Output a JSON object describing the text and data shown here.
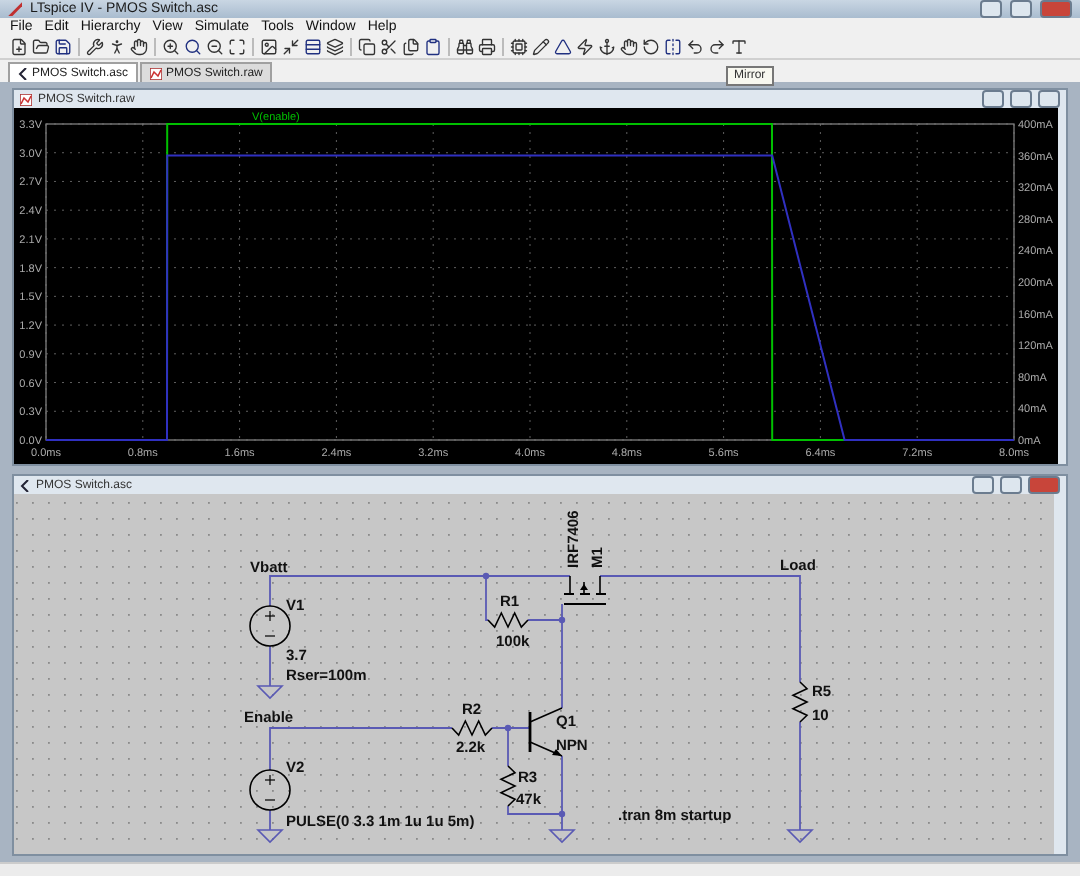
{
  "window": {
    "title": "LTspice IV - PMOS Switch.asc"
  },
  "menu": [
    "File",
    "Edit",
    "Hierarchy",
    "View",
    "Simulate",
    "Tools",
    "Window",
    "Help"
  ],
  "tabs": [
    {
      "label": "PMOS Switch.asc",
      "kind": "schematic",
      "selected": true
    },
    {
      "label": "PMOS Switch.raw",
      "kind": "waveform",
      "selected": false
    }
  ],
  "tooltip": "Mirror",
  "waveform_window": {
    "title": "PMOS Switch.raw",
    "chart_data": {
      "type": "line",
      "grid": true,
      "x": [
        0,
        1,
        1.001,
        6,
        6.001,
        6.6,
        8
      ],
      "xlim": [
        0,
        8
      ],
      "ylim": [
        0,
        3.3
      ],
      "xticks": [
        {
          "value": 0,
          "label": "0.0ms"
        },
        {
          "value": 0.8,
          "label": "0.8ms"
        },
        {
          "value": 1.6,
          "label": "1.6ms"
        },
        {
          "value": 2.4,
          "label": "2.4ms"
        },
        {
          "value": 3.2,
          "label": "3.2ms"
        },
        {
          "value": 4,
          "label": "4.0ms"
        },
        {
          "value": 4.8,
          "label": "4.8ms"
        },
        {
          "value": 5.6,
          "label": "5.6ms"
        },
        {
          "value": 6.4,
          "label": "6.4ms"
        },
        {
          "value": 7.2,
          "label": "7.2ms"
        },
        {
          "value": 8,
          "label": "8.0ms"
        }
      ],
      "yticks": [
        {
          "value": 0,
          "label": "0.0V"
        },
        {
          "value": 0.3,
          "label": "0.3V"
        },
        {
          "value": 0.6,
          "label": "0.6V"
        },
        {
          "value": 0.9,
          "label": "0.9V"
        },
        {
          "value": 1.2,
          "label": "1.2V"
        },
        {
          "value": 1.5,
          "label": "1.5V"
        },
        {
          "value": 1.8,
          "label": "1.8V"
        },
        {
          "value": 2.1,
          "label": "2.1V"
        },
        {
          "value": 2.4,
          "label": "2.4V"
        },
        {
          "value": 2.7,
          "label": "2.7V"
        },
        {
          "value": 3.0,
          "label": "3.0V"
        },
        {
          "value": 3.3,
          "label": "3.3V"
        }
      ],
      "series": [
        {
          "name": "V(enable)",
          "color": "#00c000",
          "values": [
            0,
            0,
            3.3,
            3.3,
            0,
            0,
            0
          ]
        },
        {
          "color": "#3030c0",
          "axis": "y2",
          "values": [
            0,
            0,
            360,
            360,
            360,
            0,
            0
          ]
        }
      ],
      "y2lim": [
        0,
        400
      ],
      "y2ticks": [
        {
          "value": 0,
          "label": "0mA"
        },
        {
          "value": 40,
          "label": "40mA"
        },
        {
          "value": 80,
          "label": "80mA"
        },
        {
          "value": 120,
          "label": "120mA"
        },
        {
          "value": 160,
          "label": "160mA"
        },
        {
          "value": 200,
          "label": "200mA"
        },
        {
          "value": 240,
          "label": "240mA"
        },
        {
          "value": 280,
          "label": "280mA"
        },
        {
          "value": 320,
          "label": "320mA"
        },
        {
          "value": 360,
          "label": "360mA"
        },
        {
          "value": 400,
          "label": "400mA"
        }
      ]
    }
  },
  "schematic_window": {
    "title": "PMOS Switch.asc",
    "net_labels": [
      "Vbatt",
      "Enable",
      "Load"
    ],
    "components": [
      {
        "kind": "source",
        "ref": "V1",
        "value": "3.7",
        "extra": "Rser=100m"
      },
      {
        "kind": "source",
        "ref": "V2",
        "value": "PULSE(0 3.3 1m 1u 1u 5m)"
      },
      {
        "kind": "resistor",
        "ref": "R1",
        "value": "100k"
      },
      {
        "kind": "resistor",
        "ref": "R2",
        "value": "2.2k"
      },
      {
        "kind": "resistor",
        "ref": "R3",
        "value": "47k"
      },
      {
        "kind": "resistor",
        "ref": "R5",
        "value": "10"
      },
      {
        "kind": "npn",
        "ref": "Q1",
        "value": "NPN"
      },
      {
        "kind": "pmos",
        "ref": "M1",
        "value": "IRF7406"
      }
    ],
    "directive": ".tran 8m startup"
  }
}
